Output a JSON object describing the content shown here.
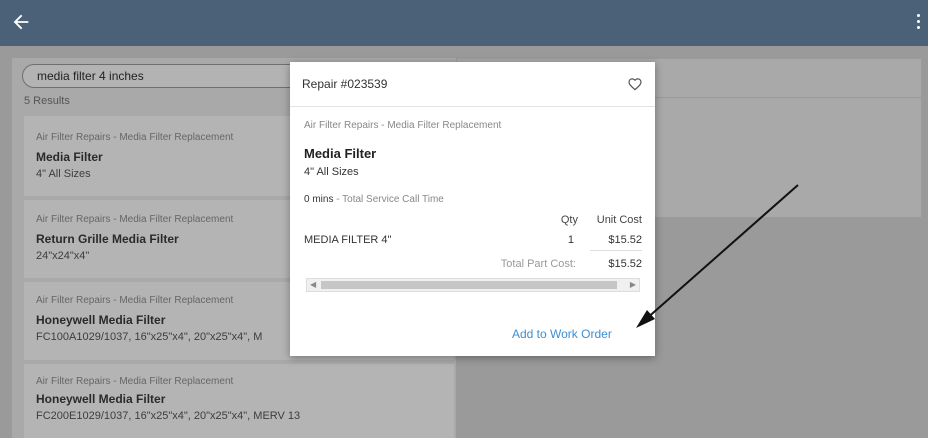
{
  "search": {
    "value": "media filter 4 inches"
  },
  "results_count": "5 Results",
  "cards": [
    {
      "category": "Air Filter Repairs - Media Filter Replacement",
      "title": "Media Filter",
      "sub": "4\" All Sizes"
    },
    {
      "category": "Air Filter Repairs - Media Filter Replacement",
      "title": "Return Grille Media Filter",
      "sub": "24\"x24\"x4\""
    },
    {
      "category": "Air Filter Repairs - Media Filter Replacement",
      "title": "Honeywell Media Filter",
      "sub": "FC100A1029/1037, 16\"x25\"x4\", 20\"x25\"x4\", M"
    },
    {
      "category": "Air Filter Repairs - Media Filter Replacement",
      "title": "Honeywell Media Filter",
      "sub": "FC200E1029/1037, 16\"x25\"x4\", 20\"x25\"x4\", MERV 13"
    }
  ],
  "popup": {
    "repair_number": "Repair #023539",
    "category": "Air Filter Repairs - Media Filter Replacement",
    "title": "Media Filter",
    "sub": "4\" All Sizes",
    "time_value": "0 mins",
    "time_label": " - Total Service Call Time",
    "col_qty": "Qty",
    "col_unit_cost": "Unit Cost",
    "part_name": "MEDIA FILTER 4\"",
    "part_qty": "1",
    "part_unit_cost": "$15.52",
    "total_label": "Total Part Cost:",
    "total_value": "$15.52",
    "add_button": "Add to Work Order"
  },
  "colors": {
    "topbar": "#4a6178",
    "link": "#3b8fd4"
  },
  "icons": {
    "back": "arrow-left-icon",
    "more": "more-vertical-icon",
    "favorite": "heart-outline-icon"
  }
}
